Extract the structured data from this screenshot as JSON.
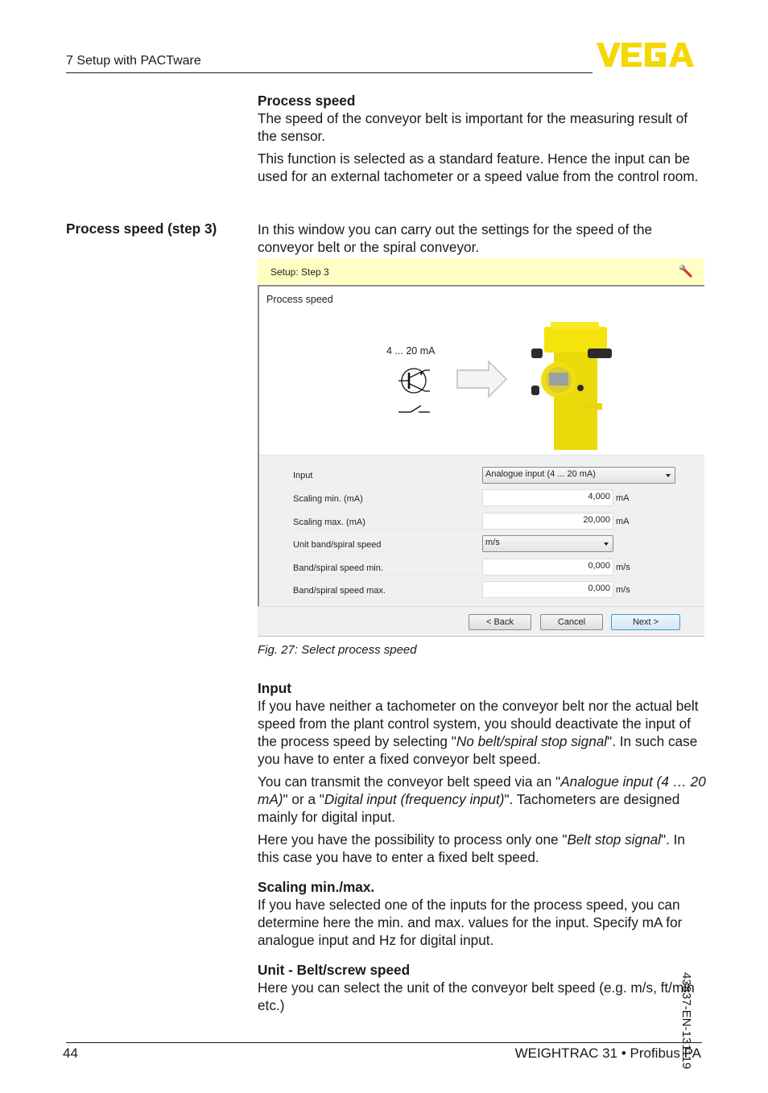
{
  "header": {
    "chapter": "7 Setup with PACTware",
    "logo_text": "VEGA",
    "logo_color": "#f5d800"
  },
  "section_process_speed": {
    "heading": "Process speed",
    "para1": "The speed of the conveyor belt is important for the measuring result of the sensor.",
    "para2": "This function is selected as a standard feature. Hence the input can be used for an external tachometer or a speed value from the control room."
  },
  "step3": {
    "side_heading": "Process speed (step 3)",
    "intro": "In this window you can carry out the settings for the speed of the conveyor belt or the spiral conveyor."
  },
  "dialog": {
    "title": "Setup: Step 3",
    "title_icon": "wrench-icon",
    "title_bar_color": "#ffffc4",
    "subtitle": "Process speed",
    "graphic": {
      "signal_label": "4 ... 20 mA",
      "symbols": [
        "transistor-icon",
        "switch-icon"
      ],
      "arrow": "right-arrow-icon",
      "device": "sensor-device-image"
    },
    "fields": [
      {
        "label": "Input",
        "type": "select",
        "value": "Analogue input (4 ... 20 mA)",
        "unit": ""
      },
      {
        "label": "Scaling min. (mA)",
        "type": "number",
        "value": "4,000",
        "unit": "mA"
      },
      {
        "label": "Scaling max. (mA)",
        "type": "number",
        "value": "20,000",
        "unit": "mA"
      },
      {
        "label": "Unit band/spiral speed",
        "type": "select",
        "value": "m/s",
        "unit": ""
      },
      {
        "label": "Band/spiral speed min.",
        "type": "number",
        "value": "0,000",
        "unit": "m/s"
      },
      {
        "label": "Band/spiral speed max.",
        "type": "number",
        "value": "0,000",
        "unit": "m/s"
      }
    ],
    "buttons": {
      "back": "< Back",
      "cancel": "Cancel",
      "next": "Next >"
    }
  },
  "figure_caption": "Fig. 27: Select process speed",
  "section_input": {
    "heading": "Input",
    "p1_a": "If you have neither a tachometer on the conveyor belt nor the actual belt speed from the plant control system, you should deactivate the input of the process speed by selecting \"",
    "p1_em": "No belt/spiral stop signal",
    "p1_b": "\". In such case you have to enter a fixed conveyor belt speed.",
    "p2_a": "You can transmit the conveyor belt speed via an \"",
    "p2_em1": "Analogue input (4 … 20 mA)",
    "p2_b": "\" or a \"",
    "p2_em2": "Digital input (frequency input)",
    "p2_c": "\". Tachometers are designed mainly for digital input.",
    "p3_a": "Here you have the possibility to process only one \"",
    "p3_em": "Belt stop signal",
    "p3_b": "\". In this case you have to enter a fixed belt speed."
  },
  "section_scaling": {
    "heading": "Scaling min./max.",
    "body": "If you have selected one of the inputs for the process speed, you can determine here the min. and max. values for the input. Specify mA for analogue input and Hz for digital input."
  },
  "section_unit": {
    "heading": "Unit - Belt/screw speed",
    "body": "Here you can select the unit of the conveyor belt speed (e.g. m/s, ft/min etc.)"
  },
  "side_doc_number": "43837-EN-131119",
  "footer": {
    "page_number": "44",
    "product": "WEIGHTRAC 31 • Profibus PA"
  }
}
